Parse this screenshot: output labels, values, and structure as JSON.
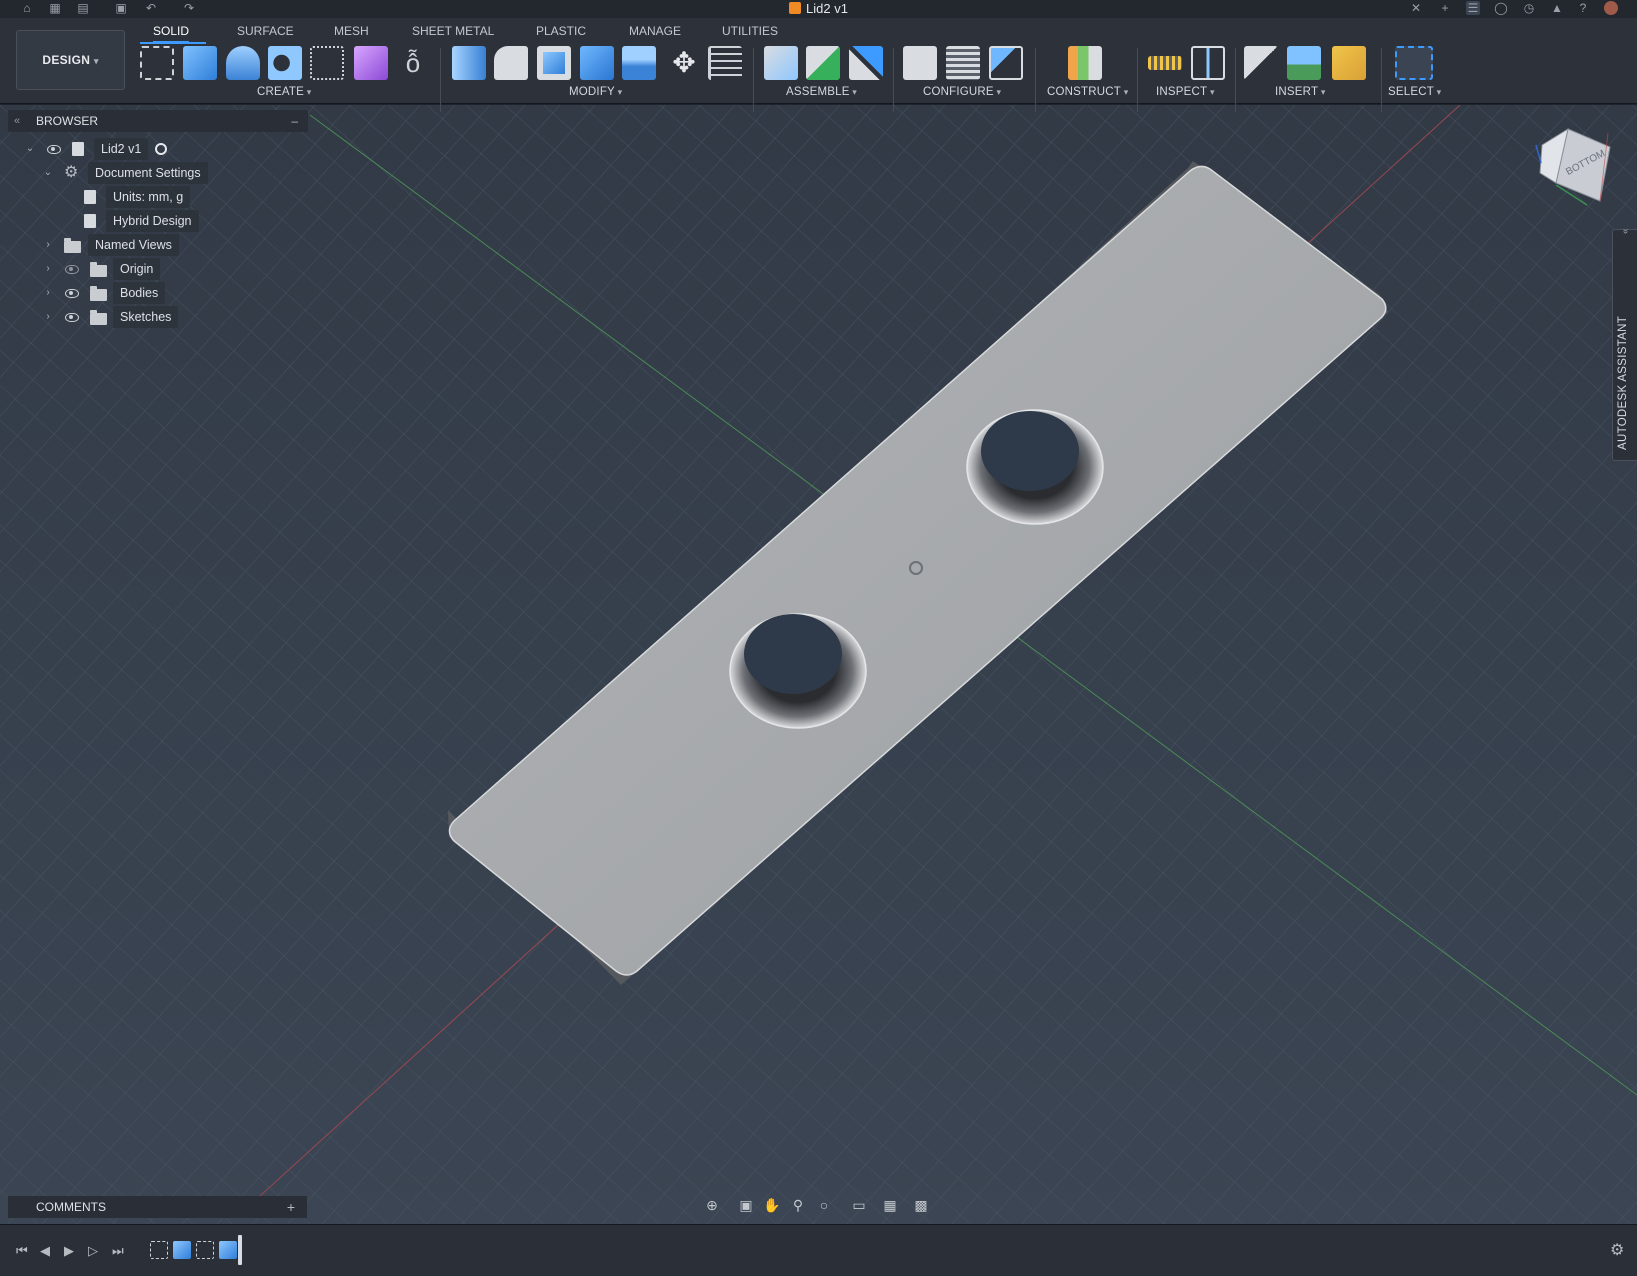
{
  "window": {
    "title": "Lid2 v1"
  },
  "workspace": {
    "label": "DESIGN"
  },
  "tabs": [
    "SOLID",
    "SURFACE",
    "MESH",
    "SHEET METAL",
    "PLASTIC",
    "MANAGE",
    "UTILITIES"
  ],
  "tool_groups": [
    "CREATE",
    "MODIFY",
    "ASSEMBLE",
    "CONFIGURE",
    "CONSTRUCT",
    "INSPECT",
    "INSERT",
    "SELECT"
  ],
  "browser": {
    "title": "BROWSER",
    "root": "Lid2 v1",
    "items": [
      "Document Settings",
      "Units: mm, g",
      "Hybrid Design",
      "Named Views",
      "Origin",
      "Bodies",
      "Sketches"
    ]
  },
  "comments": {
    "title": "COMMENTS"
  },
  "assistant": {
    "label": "AUTODESK ASSISTANT"
  },
  "viewcube": {
    "face_label": "BOTTOM"
  },
  "colors": {
    "accent": "#3d9bff",
    "viewport_bg": "#36404d",
    "body": "#a7aaae"
  }
}
